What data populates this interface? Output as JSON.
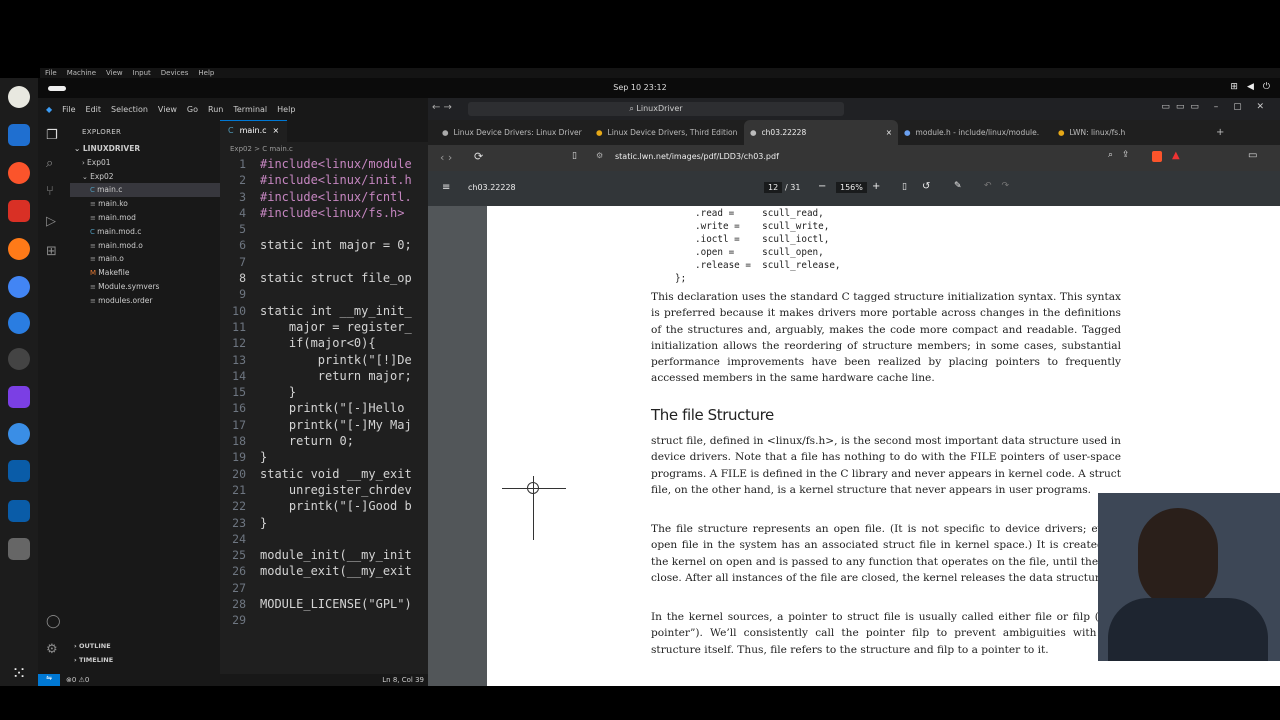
{
  "vm_menu": [
    "File",
    "Machine",
    "View",
    "Input",
    "Devices",
    "Help"
  ],
  "topbar": {
    "clock": "Sep 10  23:12"
  },
  "vscode": {
    "menu": [
      "File",
      "Edit",
      "Selection",
      "View",
      "Go",
      "Run",
      "Terminal",
      "Help"
    ],
    "explorer_title": "EXPLORER",
    "project": "LINUXDRIVER",
    "tree": [
      {
        "label": "Exp01",
        "indent": 1,
        "kind": "folder-closed"
      },
      {
        "label": "Exp02",
        "indent": 1,
        "kind": "folder-open"
      },
      {
        "label": "main.c",
        "indent": 2,
        "kind": "c",
        "selected": true
      },
      {
        "label": "main.ko",
        "indent": 2,
        "kind": "file"
      },
      {
        "label": "main.mod",
        "indent": 2,
        "kind": "file"
      },
      {
        "label": "main.mod.c",
        "indent": 2,
        "kind": "c"
      },
      {
        "label": "main.mod.o",
        "indent": 2,
        "kind": "file"
      },
      {
        "label": "main.o",
        "indent": 2,
        "kind": "file"
      },
      {
        "label": "Makefile",
        "indent": 2,
        "kind": "make"
      },
      {
        "label": "Module.symvers",
        "indent": 2,
        "kind": "file"
      },
      {
        "label": "modules.order",
        "indent": 2,
        "kind": "file"
      }
    ],
    "outline": "OUTLINE",
    "timeline": "TIMELINE",
    "tab": "main.c",
    "breadcrumb": "Exp02 > C main.c",
    "code": [
      {
        "n": "1",
        "t": "#include<linux/module"
      },
      {
        "n": "2",
        "t": "#include<linux/init.h"
      },
      {
        "n": "3",
        "t": "#include<linux/fcntl."
      },
      {
        "n": "4",
        "t": "#include<linux/fs.h>"
      },
      {
        "n": "5",
        "t": ""
      },
      {
        "n": "6",
        "t": "static int major = 0;"
      },
      {
        "n": "7",
        "t": ""
      },
      {
        "n": "8",
        "t": "static struct file_op"
      },
      {
        "n": "9",
        "t": ""
      },
      {
        "n": "10",
        "t": "static int __my_init_"
      },
      {
        "n": "11",
        "t": "    major = register_"
      },
      {
        "n": "12",
        "t": "    if(major<0){"
      },
      {
        "n": "13",
        "t": "        printk(\"[!]De"
      },
      {
        "n": "14",
        "t": "        return major;"
      },
      {
        "n": "15",
        "t": "    }"
      },
      {
        "n": "16",
        "t": "    printk(\"[-]Hello"
      },
      {
        "n": "17",
        "t": "    printk(\"[-]My Maj"
      },
      {
        "n": "18",
        "t": "    return 0;"
      },
      {
        "n": "19",
        "t": "}"
      },
      {
        "n": "20",
        "t": "static void __my_exit"
      },
      {
        "n": "21",
        "t": "    unregister_chrdev"
      },
      {
        "n": "22",
        "t": "    printk(\"[-]Good b"
      },
      {
        "n": "23",
        "t": "}"
      },
      {
        "n": "24",
        "t": ""
      },
      {
        "n": "25",
        "t": "module_init(__my_init"
      },
      {
        "n": "26",
        "t": "module_exit(__my_exit"
      },
      {
        "n": "27",
        "t": ""
      },
      {
        "n": "28",
        "t": "MODULE_LICENSE(\"GPL\")"
      },
      {
        "n": "29",
        "t": ""
      }
    ],
    "status_left": "⊗0 ⚠0",
    "status_right": "Ln 8, Col 39"
  },
  "window_title": "LinuxDriver",
  "browser": {
    "tabs": [
      "Linux Device Drivers: Linux Driver",
      "Linux Device Drivers, Third Edition",
      "ch03.22228",
      "module.h - include/linux/module.",
      "LWN: linux/fs.h"
    ],
    "url": "static.lwn.net/images/pdf/LDD3/ch03.pdf",
    "pdf_title": "ch03.22228",
    "page_current": "12",
    "page_total": "/ 31",
    "zoom": "156%"
  },
  "pdf": {
    "code_lines": [
      ".read =     scull_read,",
      ".write =    scull_write,",
      ".ioctl =    scull_ioctl,",
      ".open =     scull_open,",
      ".release =  scull_release,",
      "};"
    ],
    "para1": "This declaration uses the standard C tagged structure initialization syntax. This syntax is preferred because it makes drivers more portable across changes in the definitions of the structures and, arguably, makes the code more compact and readable. Tagged initialization allows the reordering of structure members; in some cases, substantial performance improvements have been realized by placing pointers to frequently accessed members in the same hardware cache line.",
    "heading": "The file Structure",
    "para2": "struct file, defined in <linux/fs.h>, is the second most important data structure used in device drivers. Note that a file has nothing to do with the FILE pointers of user-space programs. A FILE is defined in the C library and never appears in kernel code. A struct file, on the other hand, is a kernel structure that never appears in user programs.",
    "para3": "The file structure represents an open file. (It is not specific to device drivers; every open file in the system has an associated struct file in kernel space.) It is created by the kernel on open and is passed to any function that operates on the file, until the last close. After all instances of the file are closed, the kernel releases the data structure.",
    "para4": "In the kernel sources, a pointer to struct file is usually called either file or filp (“file pointer”). We’ll consistently call the pointer filp to prevent ambiguities with the structure itself. Thus, file refers to the structure and filp to a pointer to it."
  }
}
